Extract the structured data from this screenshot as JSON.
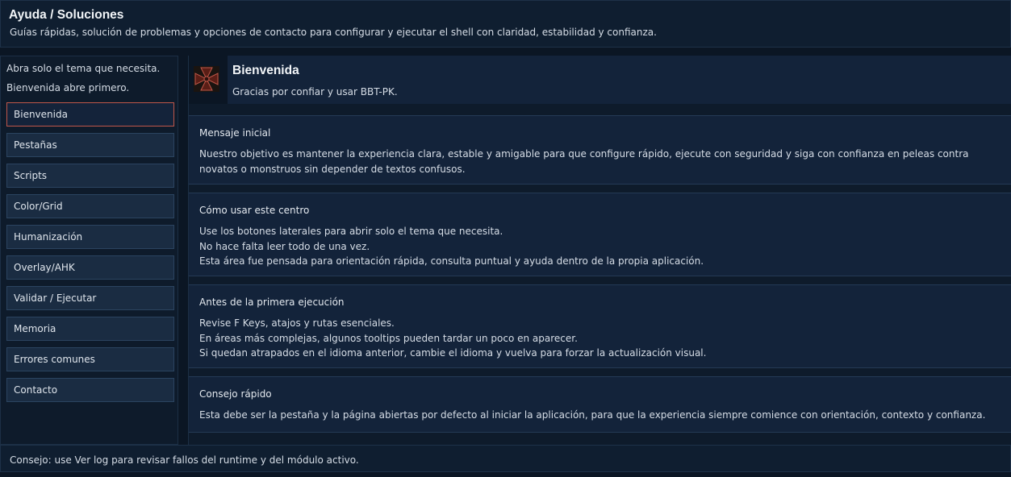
{
  "header": {
    "title": "Ayuda / Soluciones",
    "subtitle": "Guías rápidas, solución de problemas y opciones de contacto para configurar y ejecutar el shell con claridad, estabilidad y confianza."
  },
  "sidebar": {
    "note_line1": "Abra solo el tema que necesita.",
    "note_line2": "Bienvenida abre primero.",
    "items": [
      {
        "label": "Bienvenida",
        "active": true
      },
      {
        "label": "Pestañas"
      },
      {
        "label": "Scripts"
      },
      {
        "label": "Color/Grid"
      },
      {
        "label": "Humanización"
      },
      {
        "label": "Overlay/AHK"
      },
      {
        "label": "Validar / Ejecutar"
      },
      {
        "label": "Memoria"
      },
      {
        "label": "Errores comunes"
      },
      {
        "label": "Contacto"
      }
    ]
  },
  "main": {
    "logo_icon": "cross-emblem-icon",
    "accent_color": "#c0574a",
    "title": "Bienvenida",
    "subtitle": "Gracias por confiar y usar BBT-PK.",
    "cards": [
      {
        "title": "Mensaje inicial",
        "lines": [
          "Nuestro objetivo es mantener la experiencia clara, estable y amigable para que configure rápido, ejecute con seguridad y siga con confianza en peleas contra novatos o monstruos sin depender de textos confusos."
        ]
      },
      {
        "title": "Cómo usar este centro",
        "lines": [
          "Use los botones laterales para abrir solo el tema que necesita.",
          "No hace falta leer todo de una vez.",
          "Esta área fue pensada para orientación rápida, consulta puntual y ayuda dentro de la propia aplicación."
        ]
      },
      {
        "title": "Antes de la primera ejecución",
        "lines": [
          "Revise F Keys, atajos y rutas esenciales.",
          "En áreas más complejas, algunos tooltips pueden tardar un poco en aparecer.",
          "Si quedan atrapados en el idioma anterior, cambie el idioma y vuelva para forzar la actualización visual."
        ]
      },
      {
        "title": "Consejo rápido",
        "lines": [
          "Esta debe ser la pestaña y la página abiertas por defecto al iniciar la aplicación, para que la experiencia siempre comience con orientación, contexto y confianza."
        ]
      }
    ]
  },
  "footer": {
    "tip": "Consejo: use Ver log para revisar fallos del runtime y del módulo activo."
  }
}
